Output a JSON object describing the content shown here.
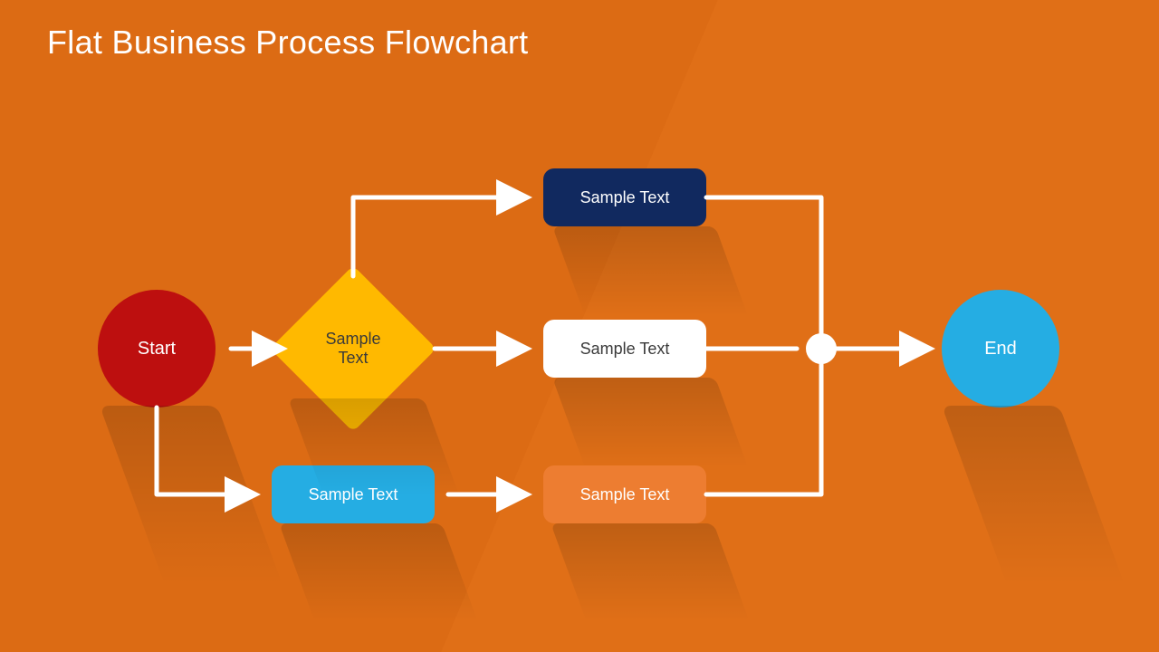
{
  "title": "Flat Business Process Flowchart",
  "nodes": {
    "start": {
      "label": "Start"
    },
    "decision": {
      "label": "Sample\nText"
    },
    "top": {
      "label": "Sample Text"
    },
    "middle": {
      "label": "Sample Text"
    },
    "bottom": {
      "label": "Sample Text"
    },
    "blue": {
      "label": "Sample Text"
    },
    "end": {
      "label": "End"
    }
  },
  "colors": {
    "background": "#dc6b14",
    "start": "#bd0f0f",
    "decision": "#ffb900",
    "top": "#11295f",
    "middle": "#ffffff",
    "bottom": "#ed7d31",
    "blue": "#25ade3",
    "end": "#25ade3",
    "connector": "#ffffff"
  }
}
